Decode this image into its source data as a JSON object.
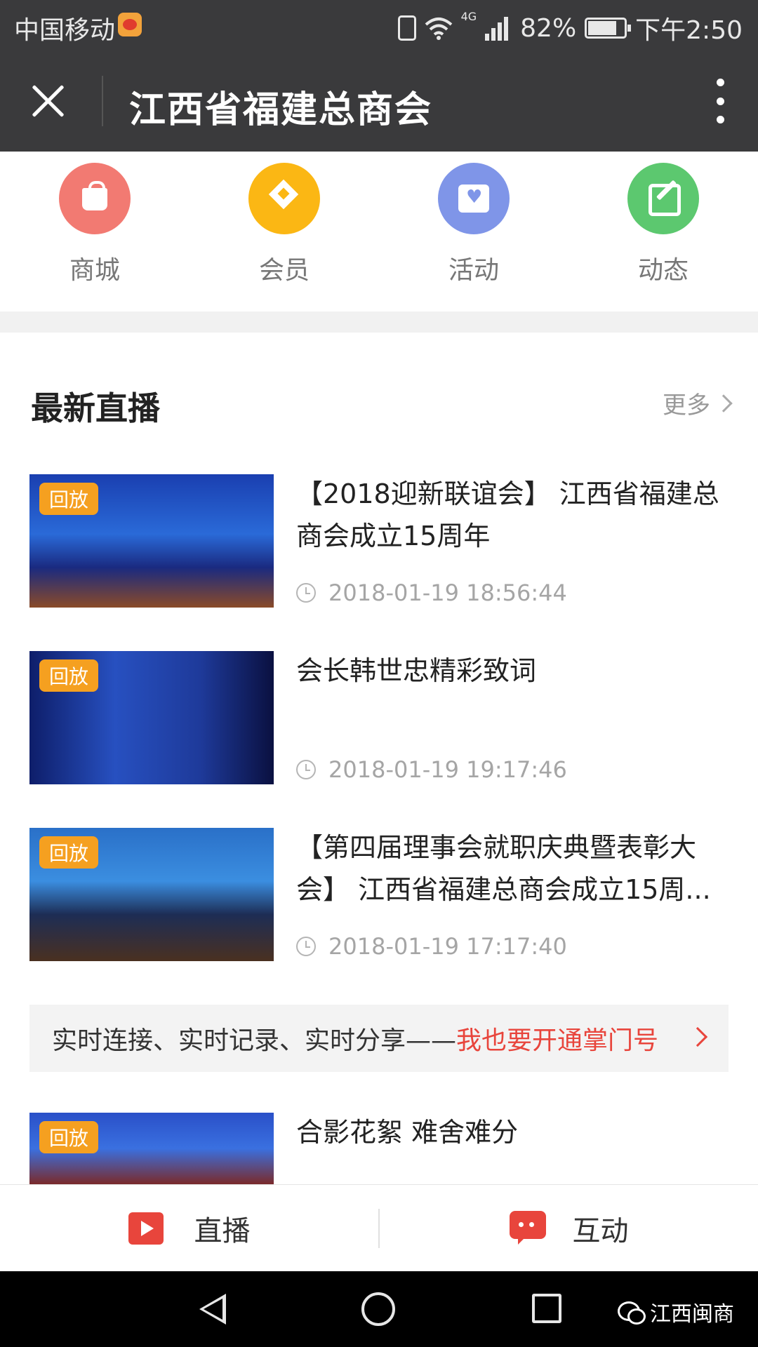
{
  "status_bar": {
    "carrier": "中国移动",
    "network": "4G",
    "battery": "82%",
    "time": "下午2:50",
    "icons": [
      "weibo-icon",
      "vibrate-icon",
      "wifi-icon",
      "signal-icon",
      "battery-icon"
    ]
  },
  "header": {
    "title": "江西省福建总商会",
    "icons": [
      "close-icon",
      "more-vertical-icon"
    ]
  },
  "quick_nav": {
    "items": [
      {
        "label": "商城",
        "icon": "shopping-bag-icon",
        "color": "#f27a72"
      },
      {
        "label": "会员",
        "icon": "diamond-icon",
        "color": "#fbb714"
      },
      {
        "label": "活动",
        "icon": "calendar-heart-icon",
        "color": "#7f95e8"
      },
      {
        "label": "动态",
        "icon": "edit-icon",
        "color": "#5cc86f"
      }
    ]
  },
  "live_section": {
    "title": "最新直播",
    "more_label": "更多",
    "items": [
      {
        "badge": "回放",
        "title": "【2018迎新联谊会】 江西省福建总商会成立15周年",
        "time": "2018-01-19 18:56:44"
      },
      {
        "badge": "回放",
        "title": "会长韩世忠精彩致词",
        "time": "2018-01-19 19:17:46"
      },
      {
        "badge": "回放",
        "title": "【第四届理事会就职庆典暨表彰大会】 江西省福建总商会成立15周...",
        "time": "2018-01-19 17:17:40"
      },
      {
        "badge": "回放",
        "title": "合影花絮 难舍难分",
        "time": ""
      }
    ]
  },
  "promo_banner": {
    "text": "实时连接、实时记录、实时分享——",
    "link": "我也要开通掌门号"
  },
  "bottom_tabs": {
    "live": "直播",
    "interact": "互动"
  },
  "watermark": {
    "text": "江西闽商"
  },
  "colors": {
    "header_bg": "#3a3a3c",
    "accent_red": "#e8453c",
    "badge_orange": "#f5a020"
  }
}
